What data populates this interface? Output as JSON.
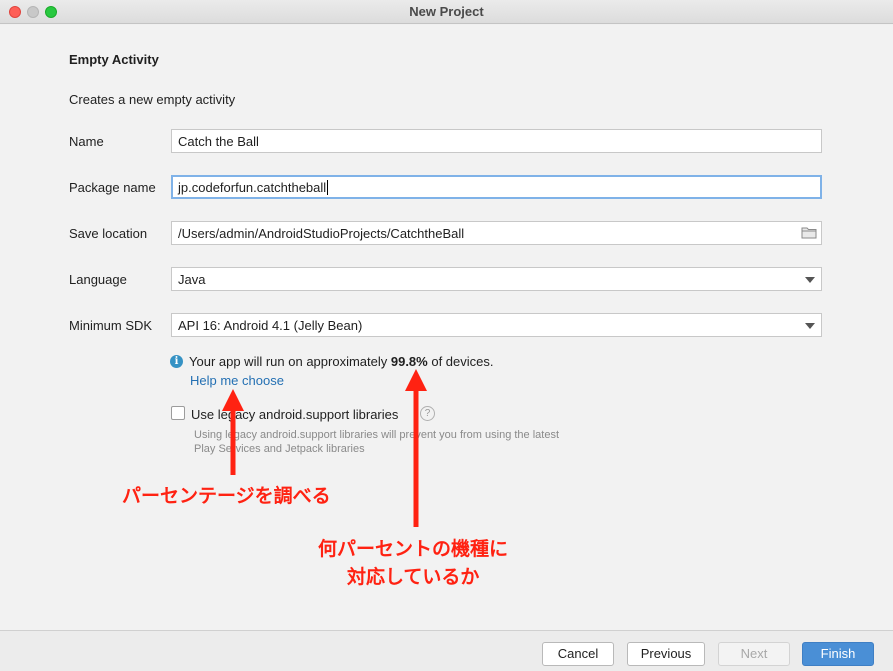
{
  "window": {
    "title": "New Project"
  },
  "form": {
    "heading": "Empty Activity",
    "description": "Creates a new empty activity",
    "name_label": "Name",
    "name_value": "Catch the Ball",
    "package_label": "Package name",
    "package_value": "jp.codeforfun.catchtheball",
    "save_label": "Save location",
    "save_value": "/Users/admin/AndroidStudioProjects/CatchtheBall",
    "language_label": "Language",
    "language_value": "Java",
    "sdk_label": "Minimum SDK",
    "sdk_value": "API 16: Android 4.1 (Jelly Bean)",
    "info_prefix": "Your app will run on approximately ",
    "info_percent": "99.8%",
    "info_suffix": " of devices.",
    "help_link": "Help me choose",
    "legacy_label": "Use legacy android.support libraries",
    "legacy_checked": false,
    "legacy_hint": "Using legacy android.support libraries will prevent you from using the latest Play Services and Jetpack libraries"
  },
  "annotations": {
    "left": "パーセンテージを調べる",
    "right_line1": "何パーセントの機種に",
    "right_line2": "対応しているか",
    "color": "#ff2212"
  },
  "buttons": {
    "cancel": "Cancel",
    "previous": "Previous",
    "next": "Next",
    "finish": "Finish"
  },
  "icons": {
    "folder": "folder-icon",
    "info": "info-icon",
    "help": "help-icon"
  }
}
